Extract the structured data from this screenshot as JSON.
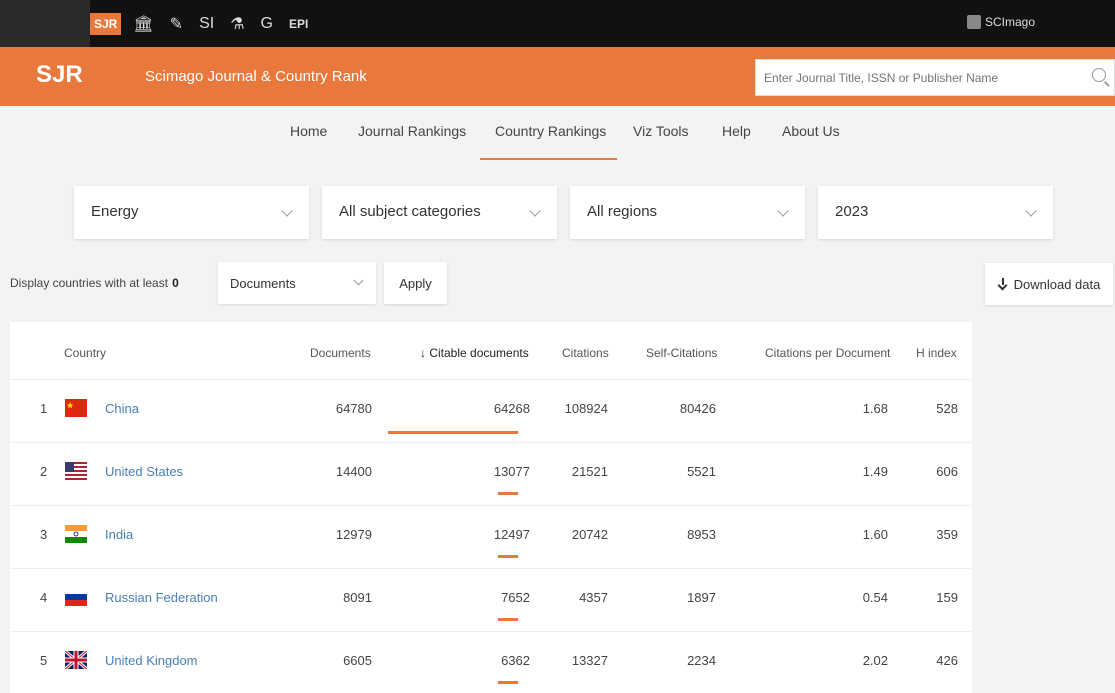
{
  "topbar": {
    "sites": [
      "SJR",
      "🏛",
      "✎",
      "SI",
      "⚗",
      "G",
      "EPI"
    ],
    "brand": "SCImago"
  },
  "header": {
    "brand": "SJR",
    "subtitle": "Scimago Journal & Country Rank",
    "search_placeholder": "Enter Journal Title, ISSN or Publisher Name"
  },
  "nav": {
    "items": [
      "Home",
      "Journal Rankings",
      "Country Rankings",
      "Viz Tools",
      "Help",
      "About Us"
    ],
    "active": "Country Rankings"
  },
  "filters": {
    "area": "Energy",
    "category": "All subject categories",
    "region": "All regions",
    "year": "2023"
  },
  "display": {
    "label": "Display countries with at least",
    "min_value": "0",
    "metric": "Documents",
    "apply_label": "Apply",
    "download_label": "Download data"
  },
  "table": {
    "headers": {
      "country": "Country",
      "documents": "Documents",
      "citable": "↓ Citable documents",
      "citations": "Citations",
      "self_citations": "Self-Citations",
      "cpd": "Citations per Document",
      "h_index": "H index"
    },
    "rows": [
      {
        "rank": "1",
        "country": "China",
        "flag": "cn",
        "documents": "64780",
        "citable": "64268",
        "citations": "108924",
        "self_citations": "80426",
        "cpd": "1.68",
        "h_index": "528"
      },
      {
        "rank": "2",
        "country": "United States",
        "flag": "us",
        "documents": "14400",
        "citable": "13077",
        "citations": "21521",
        "self_citations": "5521",
        "cpd": "1.49",
        "h_index": "606"
      },
      {
        "rank": "3",
        "country": "India",
        "flag": "in",
        "documents": "12979",
        "citable": "12497",
        "citations": "20742",
        "self_citations": "8953",
        "cpd": "1.60",
        "h_index": "359"
      },
      {
        "rank": "4",
        "country": "Russian Federation",
        "flag": "ru",
        "documents": "8091",
        "citable": "7652",
        "citations": "4357",
        "self_citations": "1897",
        "cpd": "0.54",
        "h_index": "159"
      },
      {
        "rank": "5",
        "country": "United Kingdom",
        "flag": "gb",
        "documents": "6605",
        "citable": "6362",
        "citations": "13327",
        "self_citations": "2234",
        "cpd": "2.02",
        "h_index": "426"
      }
    ]
  },
  "colors": {
    "accent": "#e8783b",
    "link": "#4a7fb5",
    "topbar": "#111111"
  }
}
